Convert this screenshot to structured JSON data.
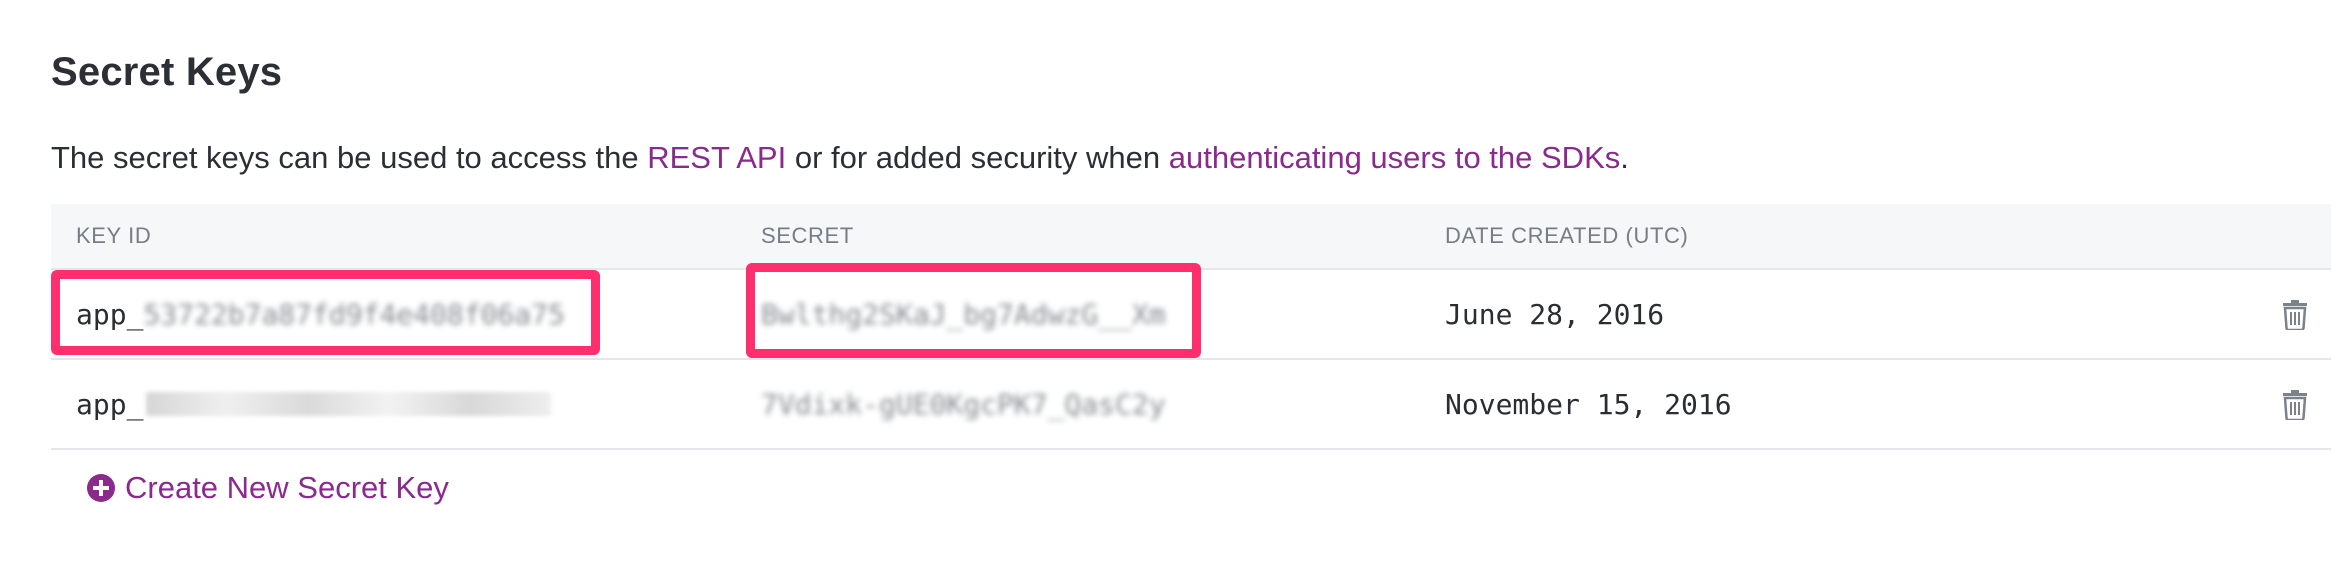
{
  "section": {
    "title": "Secret Keys",
    "description": {
      "before": "The secret keys can be used to access the ",
      "link1": "REST API",
      "middle": " or for added security when ",
      "link2": "authenticating users to the SDKs",
      "after": "."
    }
  },
  "table": {
    "headers": {
      "key_id": "KEY ID",
      "secret": "SECRET",
      "date_created": "DATE CREATED (UTC)"
    },
    "rows": [
      {
        "key_prefix": "app_",
        "key_rest": "53722b7a87fd9f4e408f06a75",
        "secret": "Bwlthg2SKaJ_bg7AdwzG__Xm",
        "date": "June 28, 2016"
      },
      {
        "key_prefix": "app_",
        "key_rest": "",
        "secret": "7Vdixk-gUE0KgcPK7_QasC2y",
        "date": "November 15, 2016"
      }
    ]
  },
  "actions": {
    "create_label": "Create New Secret Key"
  },
  "colors": {
    "accent": "#8a2a8d",
    "highlight": "#ff2f6d",
    "header_bg": "#f6f7f9"
  },
  "icons": {
    "delete": "trash-icon",
    "create": "plus-circle-icon"
  }
}
